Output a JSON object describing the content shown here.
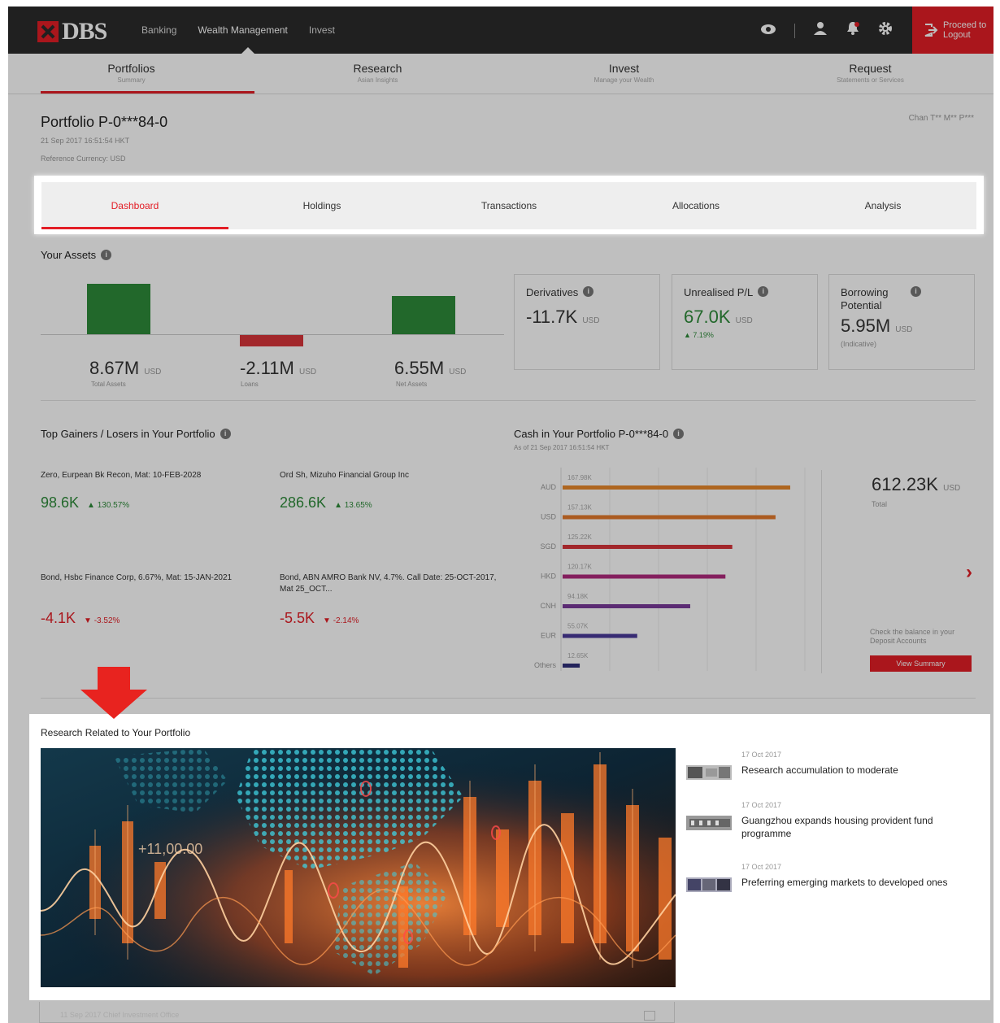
{
  "brand": {
    "name": "DBS"
  },
  "topnav": {
    "items": [
      "Banking",
      "Wealth Management",
      "Invest"
    ],
    "active": "Wealth Management"
  },
  "topbar": {
    "logout_label_1": "Proceed to",
    "logout_label_2": "Logout"
  },
  "mainnav": [
    {
      "label": "Portfolios",
      "sub": "Summary"
    },
    {
      "label": "Research",
      "sub": "Asian Insights"
    },
    {
      "label": "Invest",
      "sub": "Manage your Wealth"
    },
    {
      "label": "Request",
      "sub": "Statements or Services"
    }
  ],
  "portfolio": {
    "title": "Portfolio P-0***84-0",
    "timestamp": "21 Sep 2017 16:51:54 HKT",
    "currency": "Reference Currency: USD",
    "user": "Chan T** M** P***"
  },
  "tabs": [
    "Dashboard",
    "Holdings",
    "Transactions",
    "Allocations",
    "Analysis"
  ],
  "assets": {
    "title": "Your Assets",
    "items": [
      {
        "value": "8.67M",
        "unit": "USD",
        "label": "Total Assets",
        "amount": 8.67
      },
      {
        "value": "-2.11M",
        "unit": "USD",
        "label": "Loans",
        "amount": -2.11
      },
      {
        "value": "6.55M",
        "unit": "USD",
        "label": "Net Assets",
        "amount": 6.55
      }
    ],
    "cards": [
      {
        "title": "Derivatives",
        "value": "-11.7K",
        "unit": "USD",
        "note": ""
      },
      {
        "title": "Unrealised P/L",
        "value": "67.0K",
        "unit": "USD",
        "note": "▲ 7.19%"
      },
      {
        "title": "Borrowing Potential",
        "value": "5.95M",
        "unit": "USD",
        "note": "(Indicative)"
      }
    ]
  },
  "gainers": {
    "title": "Top Gainers / Losers in Your Portfolio",
    "items": [
      {
        "name": "Zero, Eurpean Bk Recon, Mat: 10-FEB-2028",
        "value": "98.6K",
        "change": "▲ 130.57%"
      },
      {
        "name": "Ord Sh, Mizuho Financial Group Inc",
        "value": "286.6K",
        "change": "▲ 13.65%"
      },
      {
        "name": "Bond, Hsbc Finance Corp, 6.67%, Mat: 15-JAN-2021",
        "value": "-4.1K",
        "change": "▼ -3.52%"
      },
      {
        "name": "Bond, ABN AMRO Bank NV, 4.7%. Call Date: 25-OCT-2017, Mat 25_OCT...",
        "value": "-5.5K",
        "change": "▼ -2.14%"
      }
    ]
  },
  "cash": {
    "title": "Cash in Your Portfolio P-0***84-0",
    "asof": "As of 21 Sep 2017 16:51:54 HKT",
    "total": "612.23K",
    "total_unit": "USD",
    "total_label": "Total",
    "check_note": "Check the balance in your Deposit Accounts",
    "button": "View Summary"
  },
  "chart_data": {
    "type": "bar",
    "orientation": "horizontal",
    "categories": [
      "AUD",
      "USD",
      "SGD",
      "HKD",
      "CNH",
      "EUR",
      "Others"
    ],
    "values": [
      167.98,
      157.13,
      125.22,
      120.17,
      94.18,
      55.07,
      12.65
    ],
    "labels": [
      "167.98K",
      "157.13K",
      "125.22K",
      "120.17K",
      "94.18K",
      "55.07K",
      "12.65K"
    ],
    "colors": [
      "#e8892b",
      "#e47a2b",
      "#d9343a",
      "#b02a7e",
      "#7a3a9a",
      "#4a3a9a",
      "#2f2f7a"
    ],
    "title": "Cash in Your Portfolio P-0***84-0",
    "xlim": [
      0,
      180
    ]
  },
  "research": {
    "title": "Research Related to Your Portfolio",
    "hero_text": "+11,00.00",
    "news": [
      {
        "date": "17 Oct 2017",
        "title": "Research accumulation to moderate"
      },
      {
        "date": "17 Oct 2017",
        "title": "Guangzhou expands housing provident fund programme"
      },
      {
        "date": "17 Oct 2017",
        "title": "Preferring emerging markets to developed ones"
      }
    ],
    "footer": "11 Sep 2017 Chief Investment Office"
  }
}
